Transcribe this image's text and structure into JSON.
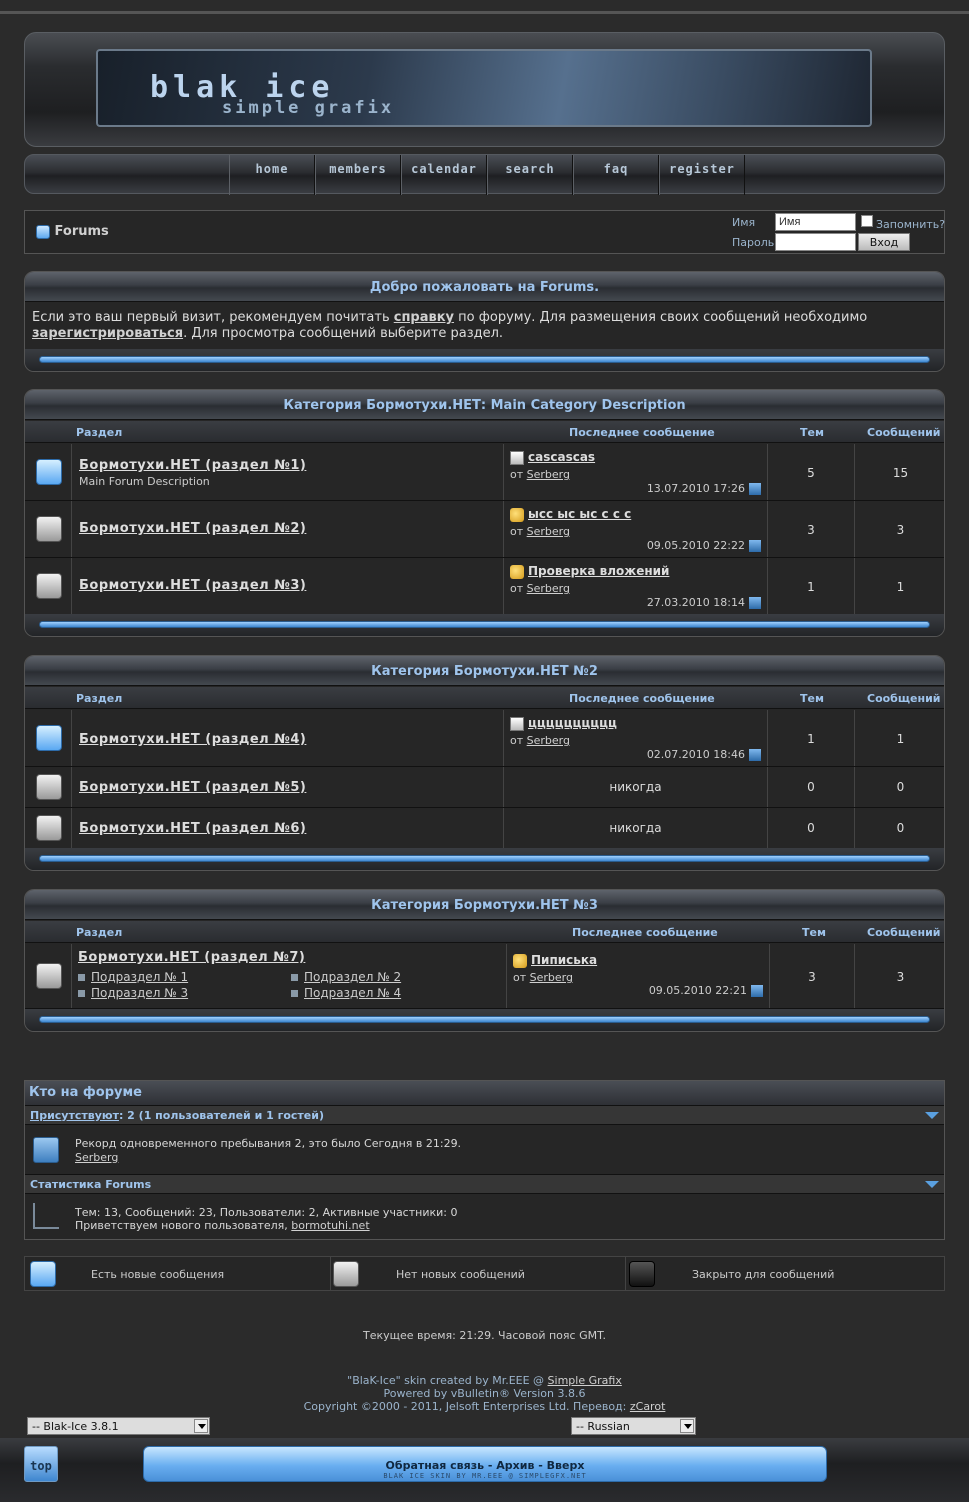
{
  "header": {
    "logo_main": "BlaK Ice",
    "logo_sub": "simple grafix"
  },
  "nav": [
    "home",
    "members",
    "calendar",
    "search",
    "faq",
    "register"
  ],
  "login": {
    "forum_name": "Forums",
    "name_label": "Имя",
    "name_placeholder": "Имя",
    "remember_label": "Запомнить?",
    "password_label": "Пароль",
    "login_button": "Вход"
  },
  "welcome": {
    "title": "Добро пожаловать на Forums.",
    "text_1": "Если это ваш первый визит, рекомендуем почитать ",
    "link_help": "справку",
    "text_2": " по форуму. Для размещения своих сообщений необходимо ",
    "link_register": "зарегистрироваться",
    "text_3": ". Для просмотра сообщений выберите раздел."
  },
  "columns": {
    "section": "Раздел",
    "last_post": "Последнее сообщение",
    "threads": "Тем",
    "posts": "Сообщений"
  },
  "categories": [
    {
      "title": "Категория Бормотухи.НЕТ: Main Category Description",
      "forums": [
        {
          "name": "Бормотухи.НЕТ (раздел №1)",
          "desc": "Main Forum Description",
          "status": "new",
          "last_title": "cascascas",
          "from": "от",
          "by": "Serberg",
          "date": "13.07.2010",
          "time": "17:26",
          "threads": "5",
          "posts": "15",
          "icon": "doc"
        },
        {
          "name": "Бормотухи.НЕТ (раздел №2)",
          "status": "old",
          "last_title": "ысс ыс ыс с с с",
          "from": "от",
          "by": "Serberg",
          "date": "09.05.2010",
          "time": "22:22",
          "threads": "3",
          "posts": "3",
          "icon": "thumb"
        },
        {
          "name": "Бормотухи.НЕТ (раздел №3)",
          "status": "old",
          "last_title": "Проверка вложений",
          "from": "от",
          "by": "Serberg",
          "date": "27.03.2010",
          "time": "18:14",
          "threads": "1",
          "posts": "1",
          "icon": "thumb"
        }
      ]
    },
    {
      "title": "Категория Бормотухи.НЕТ №2",
      "forums": [
        {
          "name": "Бормотухи.НЕТ (раздел №4)",
          "status": "new",
          "last_title": "цццццццццц",
          "from": "от",
          "by": "Serberg",
          "date": "02.07.2010",
          "time": "18:46",
          "threads": "1",
          "posts": "1",
          "icon": "doc"
        },
        {
          "name": "Бормотухи.НЕТ (раздел №5)",
          "status": "old",
          "last": "никогда",
          "threads": "0",
          "posts": "0"
        },
        {
          "name": "Бормотухи.НЕТ (раздел №6)",
          "status": "old",
          "last": "никогда",
          "threads": "0",
          "posts": "0"
        }
      ]
    },
    {
      "title": "Категория Бормотухи.НЕТ №3",
      "forums": [
        {
          "name": "Бормотухи.НЕТ (раздел №7)",
          "status": "old",
          "subforums": [
            "Подраздел № 1",
            "Подраздел № 2",
            "Подраздел № 3",
            "Подраздел № 4"
          ],
          "last_title": "Пиписька",
          "from": "от",
          "by": "Serberg",
          "date": "09.05.2010",
          "time": "22:21",
          "threads": "3",
          "posts": "3",
          "icon": "thumb"
        }
      ]
    }
  ],
  "online": {
    "title": "Кто на форуме",
    "present_label": "Присутствуют",
    "present_value": ": 2 (1 пользователей и 1 гостей)",
    "record": "Рекорд одновременного пребывания 2, это было Сегодня в 21:29.",
    "user": "Serberg",
    "stats_title": "Статистика Forums",
    "stats": "Тем: 13, Сообщений: 23, Пользователи: 2, Активные участники: 0",
    "welcome_new": "Приветствуем нового пользователя, ",
    "new_user": "bormotuhi.net"
  },
  "legend": {
    "new": "Есть новые сообщения",
    "old": "Нет новых сообщений",
    "closed": "Закрыто для сообщений"
  },
  "footer": {
    "time": "Текущее время: 21:29. Часовой пояс GMT.",
    "skin_1": "\"BlaK-Ice\" skin created by Mr.EEE @ ",
    "skin_link": "Simple Grafix",
    "powered": "Powered by vBulletin® Version 3.8.6",
    "copyright": "Copyright ©2000 - 2011, Jelsoft Enterprises Ltd. Перевод: ",
    "copyright_link": "zCarot",
    "style_select": "-- Blak-Ice 3.8.1",
    "lang_select": "-- Russian",
    "links": "Обратная связь - Архив - Вверх",
    "credit": "BLAK ICE SKIN BY MR.EEE @ SIMPLEGFX.NET",
    "top_button": "top"
  },
  "colors": {
    "accent": "#9fc4ec",
    "new_icon": "#5aa8f2",
    "background": "#2b2b2b"
  }
}
